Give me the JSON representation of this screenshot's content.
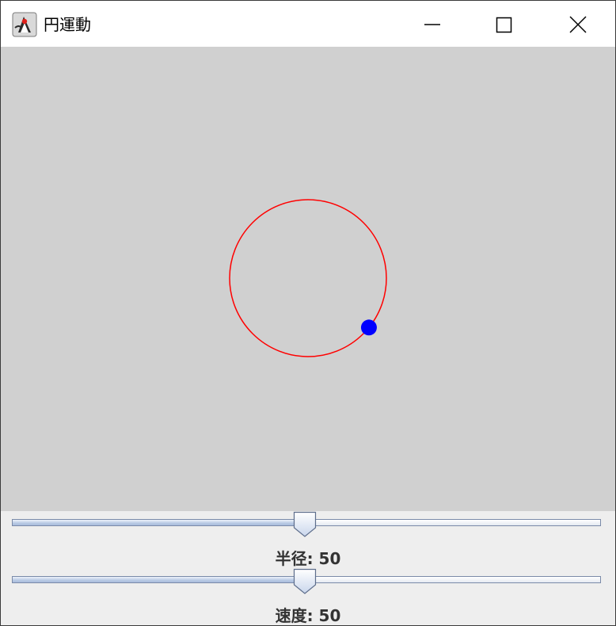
{
  "window": {
    "title": "円運動",
    "icon": "java-duke-icon"
  },
  "window_controls": {
    "minimize_icon": "minimize-icon",
    "maximize_icon": "maximize-icon",
    "close_icon": "close-icon"
  },
  "canvas": {
    "background": "#d0d0d0",
    "orbit_color": "#ff0000",
    "ball_color": "#0000ff",
    "ball_angle_deg": 39
  },
  "sliders": [
    {
      "label_name": "半径",
      "label": "半径: 50",
      "value": 50,
      "min": 0,
      "max": 100
    },
    {
      "label_name": "速度",
      "label": "速度: 50",
      "value": 50,
      "min": 0,
      "max": 100
    }
  ]
}
